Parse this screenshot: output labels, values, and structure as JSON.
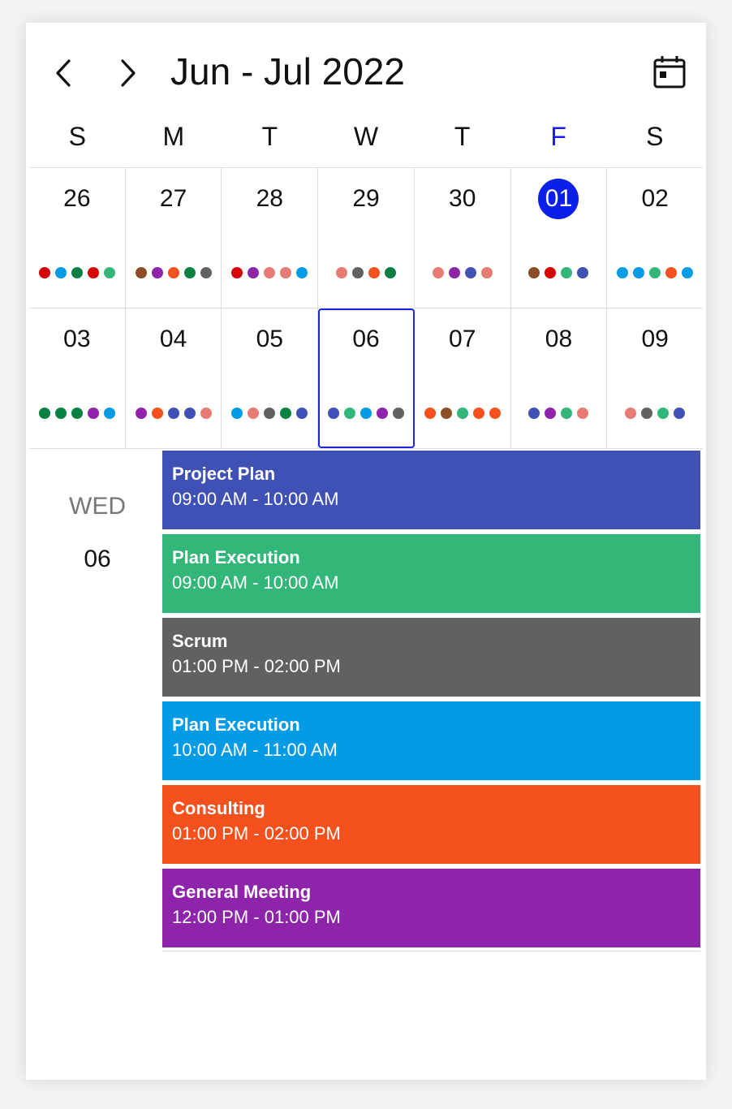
{
  "header": {
    "title": "Jun - Jul 2022"
  },
  "icons": {
    "prev": "chevron-left-icon",
    "next": "chevron-right-icon",
    "today": "calendar-today-icon"
  },
  "colors": {
    "today_circle": "#0c1fe8",
    "today_label": "#1a1aff",
    "selection_border": "#1a28d8",
    "red": "#d50000",
    "blue": "#039be5",
    "green": "#0b8043",
    "teal": "#33b679",
    "purple": "#8e24aa",
    "orange": "#f4511e",
    "gray": "#616161",
    "brown": "#8d4e27",
    "salmon": "#e67c73",
    "indigo": "#3f51b5"
  },
  "weekdays": [
    {
      "label": "S"
    },
    {
      "label": "M"
    },
    {
      "label": "T"
    },
    {
      "label": "W"
    },
    {
      "label": "T"
    },
    {
      "label": "F",
      "today": true
    },
    {
      "label": "S"
    }
  ],
  "weeks": [
    [
      {
        "day": "26",
        "dots": [
          "#d50000",
          "#039be5",
          "#0b8043",
          "#d50000",
          "#33b679"
        ]
      },
      {
        "day": "27",
        "dots": [
          "#8d4e27",
          "#8e24aa",
          "#f4511e",
          "#0b8043",
          "#616161"
        ]
      },
      {
        "day": "28",
        "dots": [
          "#d50000",
          "#8e24aa",
          "#e67c73",
          "#e67c73",
          "#039be5"
        ]
      },
      {
        "day": "29",
        "dots": [
          "#e67c73",
          "#616161",
          "#f4511e",
          "#0b8043"
        ]
      },
      {
        "day": "30",
        "dots": [
          "#e67c73",
          "#8e24aa",
          "#3f51b5",
          "#e67c73"
        ]
      },
      {
        "day": "01",
        "today": true,
        "dots": [
          "#8d4e27",
          "#d50000",
          "#33b679",
          "#3f51b5"
        ]
      },
      {
        "day": "02",
        "dots": [
          "#039be5",
          "#039be5",
          "#33b679",
          "#f4511e",
          "#039be5"
        ]
      }
    ],
    [
      {
        "day": "03",
        "dots": [
          "#0b8043",
          "#0b8043",
          "#0b8043",
          "#8e24aa",
          "#039be5"
        ]
      },
      {
        "day": "04",
        "dots": [
          "#8e24aa",
          "#f4511e",
          "#3f51b5",
          "#3f51b5",
          "#e67c73"
        ]
      },
      {
        "day": "05",
        "dots": [
          "#039be5",
          "#e67c73",
          "#616161",
          "#0b8043",
          "#3f51b5"
        ]
      },
      {
        "day": "06",
        "selected": true,
        "dots": [
          "#3f51b5",
          "#33b679",
          "#039be5",
          "#8e24aa",
          "#616161"
        ]
      },
      {
        "day": "07",
        "dots": [
          "#f4511e",
          "#8d4e27",
          "#33b679",
          "#f4511e",
          "#f4511e"
        ]
      },
      {
        "day": "08",
        "dots": [
          "#3f51b5",
          "#8e24aa",
          "#33b679",
          "#e67c73"
        ]
      },
      {
        "day": "09",
        "dots": [
          "#e67c73",
          "#616161",
          "#33b679",
          "#3f51b5"
        ]
      }
    ]
  ],
  "agenda": {
    "weekday": "WED",
    "date": "06",
    "events": [
      {
        "title": "Project Plan",
        "time": "09:00 AM - 10:00 AM",
        "color": "#3f51b5"
      },
      {
        "title": "Plan Execution",
        "time": "09:00 AM - 10:00 AM",
        "color": "#33b679"
      },
      {
        "title": "Scrum",
        "time": "01:00 PM - 02:00 PM",
        "color": "#616161"
      },
      {
        "title": "Plan Execution",
        "time": "10:00 AM - 11:00 AM",
        "color": "#039be5"
      },
      {
        "title": "Consulting",
        "time": "01:00 PM - 02:00 PM",
        "color": "#f4511e"
      },
      {
        "title": "General Meeting",
        "time": "12:00 PM - 01:00 PM",
        "color": "#8e24aa"
      }
    ]
  }
}
